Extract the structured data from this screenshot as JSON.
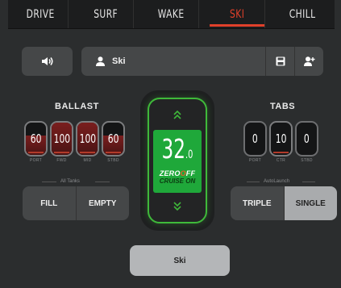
{
  "tabs": [
    {
      "label": "DRIVE",
      "active": false
    },
    {
      "label": "SURF",
      "active": false
    },
    {
      "label": "WAKE",
      "active": false
    },
    {
      "label": "SKI",
      "active": true
    },
    {
      "label": "CHILL",
      "active": false
    }
  ],
  "profile": {
    "name": "Ski"
  },
  "ballast": {
    "title": "BALLAST",
    "tanks": [
      {
        "label": "PORT",
        "value": "60",
        "fill": 0.6
      },
      {
        "label": "FWD",
        "value": "100",
        "fill": 1.0
      },
      {
        "label": "MID",
        "value": "100",
        "fill": 1.0
      },
      {
        "label": "STBD",
        "value": "60",
        "fill": 0.6
      }
    ],
    "group_label": "All Tanks",
    "fill_label": "FILL",
    "empty_label": "EMPTY"
  },
  "tabs_trim": {
    "title": "TABS",
    "items": [
      {
        "label": "PORT",
        "value": "0"
      },
      {
        "label": "CTR",
        "value": "10"
      },
      {
        "label": "STBD",
        "value": "0"
      }
    ],
    "group_label": "AutoLaunch",
    "triple_label": "TRIPLE",
    "single_label": "SINGLE"
  },
  "speed": {
    "whole": "32",
    "decimal": ".0",
    "brand_pre": "ZERO",
    "brand_o": "O",
    "brand_post": "FF",
    "mode": "CRUISE ON"
  },
  "bottom_button": {
    "label": "Ski"
  },
  "colors": {
    "accent": "#e0402a",
    "speed_green": "#1fa83a",
    "panel_border": "#3fb93a"
  }
}
